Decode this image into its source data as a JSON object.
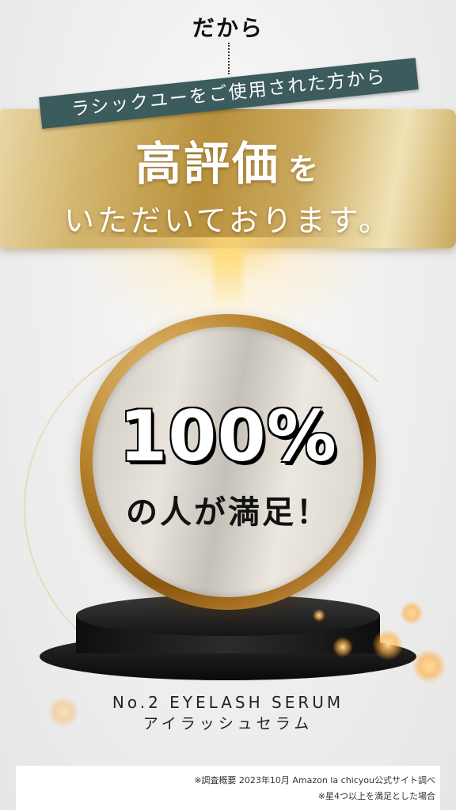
{
  "header": {
    "lead": "だから",
    "ribbon": "ラシックユーをご使用された方から"
  },
  "banner": {
    "title_main": "高評価",
    "title_particle": "を",
    "subtitle": "いただいております。"
  },
  "medal": {
    "percent": "100%",
    "caption": "の人が満足！"
  },
  "product": {
    "name_en": "No.2 EYELASH SERUM",
    "name_jp": "アイラッシュセラム"
  },
  "footnote": {
    "line1": "※調査概要 2023年10月 Amazon la chicyou公式サイト調べ",
    "line2": "※星4つ以上を満足とした場合"
  },
  "colors": {
    "ribbon_bg": "#3c5b5c",
    "gold": "#c9a75a"
  }
}
